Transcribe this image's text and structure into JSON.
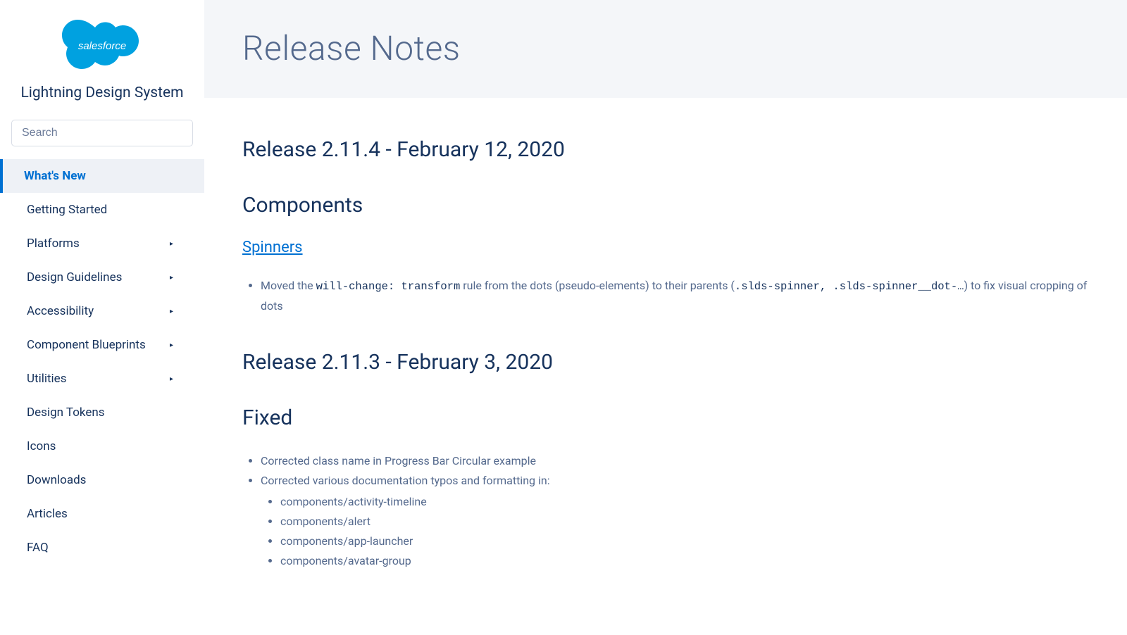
{
  "brand": {
    "logo_text": "salesforce",
    "title": "Lightning Design System"
  },
  "search": {
    "placeholder": "Search"
  },
  "sidebar": {
    "items": [
      {
        "label": "What's New",
        "active": true,
        "has_caret": false
      },
      {
        "label": "Getting Started",
        "active": false,
        "has_caret": false
      },
      {
        "label": "Platforms",
        "active": false,
        "has_caret": true
      },
      {
        "label": "Design Guidelines",
        "active": false,
        "has_caret": true
      },
      {
        "label": "Accessibility",
        "active": false,
        "has_caret": true
      },
      {
        "label": "Component Blueprints",
        "active": false,
        "has_caret": true
      },
      {
        "label": "Utilities",
        "active": false,
        "has_caret": true
      },
      {
        "label": "Design Tokens",
        "active": false,
        "has_caret": false
      },
      {
        "label": "Icons",
        "active": false,
        "has_caret": false
      },
      {
        "label": "Downloads",
        "active": false,
        "has_caret": false
      },
      {
        "label": "Articles",
        "active": false,
        "has_caret": false
      },
      {
        "label": "FAQ",
        "active": false,
        "has_caret": false
      }
    ]
  },
  "page": {
    "title": "Release Notes"
  },
  "releases": {
    "r1": {
      "heading": "Release 2.11.4 - February 12, 2020",
      "section": "Components",
      "component_link": "Spinners",
      "bullet_pre": "Moved the ",
      "bullet_code1": "will-change: transform",
      "bullet_mid": " rule from the dots (pseudo-elements) to their parents (",
      "bullet_code2": ".slds-spinner, .slds-spinner__dot-…",
      "bullet_post": ") to fix visual cropping of dots"
    },
    "r2": {
      "heading": "Release 2.11.3 - February 3, 2020",
      "section": "Fixed",
      "bullets": [
        "Corrected class name in Progress Bar Circular example",
        "Corrected various documentation typos and formatting in:"
      ],
      "nested": [
        "components/activity-timeline",
        "components/alert",
        "components/app-launcher",
        "components/avatar-group"
      ]
    }
  }
}
